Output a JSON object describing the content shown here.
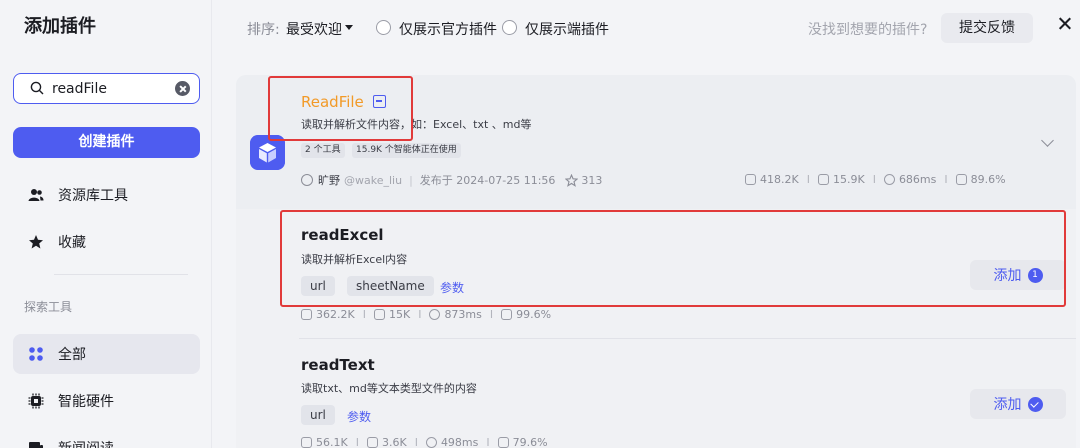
{
  "sidebar": {
    "title": "添加插件",
    "search": {
      "value": "readFile",
      "placeholder": ""
    },
    "create_label": "创建插件",
    "items": [
      {
        "label": "资源库工具",
        "icon": "users-icon"
      },
      {
        "label": "收藏",
        "icon": "star-icon"
      }
    ],
    "section_label": "探索工具",
    "explore_items": [
      {
        "label": "全部",
        "icon": "grid-icon",
        "active": true
      },
      {
        "label": "智能硬件",
        "icon": "chip-icon"
      },
      {
        "label": "新闻阅读",
        "icon": "news-icon"
      }
    ]
  },
  "topbar": {
    "sort_label": "排序:",
    "sort_value": "最受欢迎",
    "filter_official": "仅展示官方插件",
    "filter_client": "仅展示端插件",
    "hint": "没找到想要的插件?",
    "feedback_label": "提交反馈"
  },
  "plugin": {
    "name": "ReadFile",
    "description": "读取并解析文件内容，如：Excel、txt 、md等",
    "tags": [
      "2 个工具",
      "15.9K 个智能体正在使用"
    ],
    "author_name": "旷野",
    "author_handle": "@wake_liu",
    "published": "发布于 2024-07-25 11:56",
    "stars": "313",
    "stats": {
      "calls": "418.2K",
      "bots": "15.9K",
      "latency": "686ms",
      "success": "89.6%"
    }
  },
  "tools": [
    {
      "name": "readExcel",
      "description": "读取并解析Excel内容",
      "params": [
        "url",
        "sheetName"
      ],
      "params_link": "参数",
      "action_label": "添加",
      "badge": "1",
      "stats": {
        "calls": "362.2K",
        "bots": "15K",
        "latency": "873ms",
        "success": "99.6%"
      }
    },
    {
      "name": "readText",
      "description": "读取txt、md等文本类型文件的内容",
      "params": [
        "url"
      ],
      "params_link": "参数",
      "action_label": "添加",
      "stats": {
        "calls": "56.1K",
        "bots": "3.6K",
        "latency": "498ms",
        "success": "79.6%"
      }
    }
  ],
  "colors": {
    "accent": "#4e5cf0",
    "plugin_name": "#f29a28",
    "highlight": "#e13a3a"
  }
}
